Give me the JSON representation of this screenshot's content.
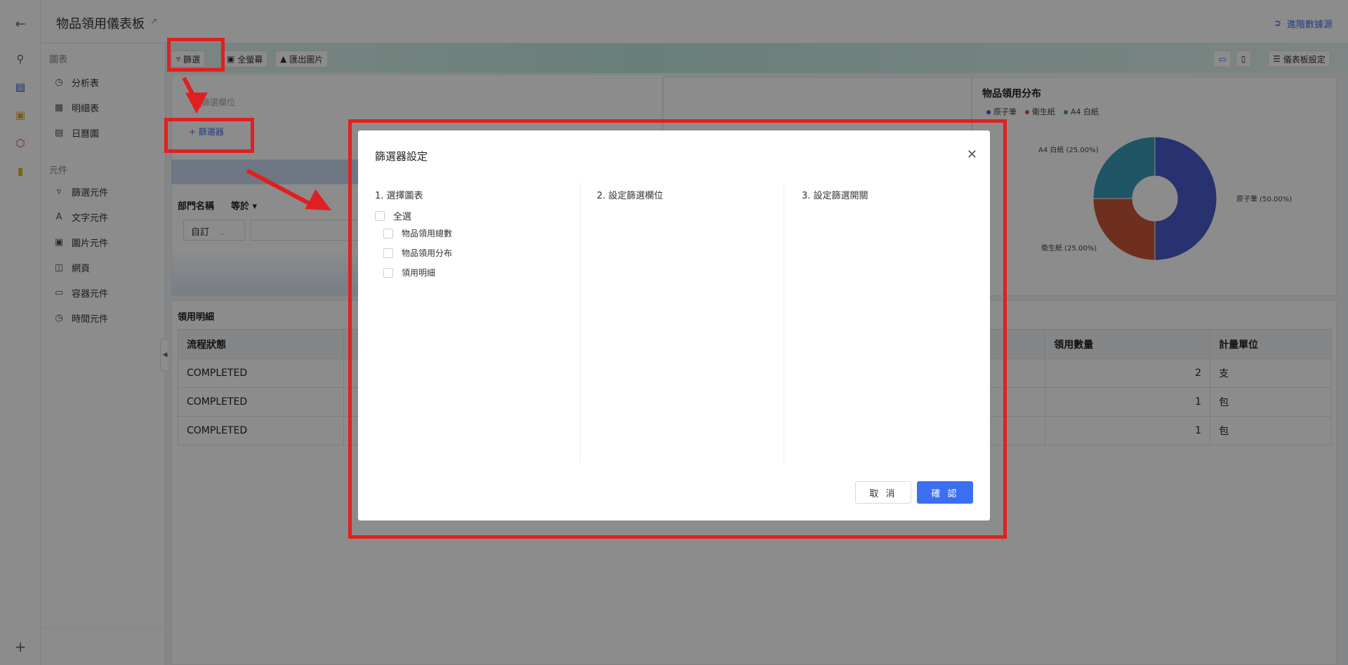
{
  "header": {
    "title": "物品領用儀表板",
    "advanced_label": "進階數據源"
  },
  "sidebar": {
    "section_charts": "圖表",
    "charts": [
      "分析表",
      "明細表",
      "日曆圖"
    ],
    "section_components": "元件",
    "components": [
      "篩選元件",
      "文字元件",
      "圖片元件",
      "網頁",
      "容器元件",
      "時間元件"
    ]
  },
  "toolbar": {
    "filter_label": "篩選",
    "fullscreen_label": "全螢幕",
    "export_label": "匯出圖片",
    "dashboard_settings_label": "儀表板設定"
  },
  "filter_panel": {
    "placeholder_hint": "請篩選欄位",
    "add_filter_label": "+ 篩選器",
    "field_name": "部門名稱",
    "operator": "等於",
    "mode_value": "自訂"
  },
  "pie_card": {
    "title": "物品領用分布",
    "legend": [
      "原子筆",
      "衛生紙",
      "A4 白紙"
    ],
    "labels": [
      "原子筆 (50.00%)",
      "衛生紙 (25.00%)",
      "A4 白紙 (25.00%)"
    ]
  },
  "chart_data": {
    "type": "pie",
    "title": "物品領用分布",
    "categories": [
      "原子筆",
      "衛生紙",
      "A4 白紙"
    ],
    "values": [
      50,
      25,
      25
    ],
    "colors": [
      "#4a5bc8",
      "#c8563a",
      "#3a9bb8"
    ],
    "donut": true
  },
  "detail_table": {
    "title": "領用明細",
    "headers": {
      "status": "流程狀態",
      "qty": "領用數量",
      "unit": "計量單位"
    },
    "rows": [
      {
        "status": "COMPLETED",
        "qty": "2",
        "unit": "支"
      },
      {
        "status": "COMPLETED",
        "qty": "1",
        "unit": "包"
      },
      {
        "status": "COMPLETED",
        "qty": "1",
        "unit": "包"
      }
    ]
  },
  "modal": {
    "title": "篩選器設定",
    "step1": "1. 選擇圖表",
    "step2": "2. 設定篩選欄位",
    "step3": "3. 設定篩選開關",
    "select_all": "全選",
    "charts": [
      "物品領用總數",
      "物品領用分布",
      "領用明細"
    ],
    "cancel_label": "取 消",
    "confirm_label": "確 認"
  },
  "colors": {
    "accent": "#3b6ff2",
    "annotation": "#e02020"
  }
}
